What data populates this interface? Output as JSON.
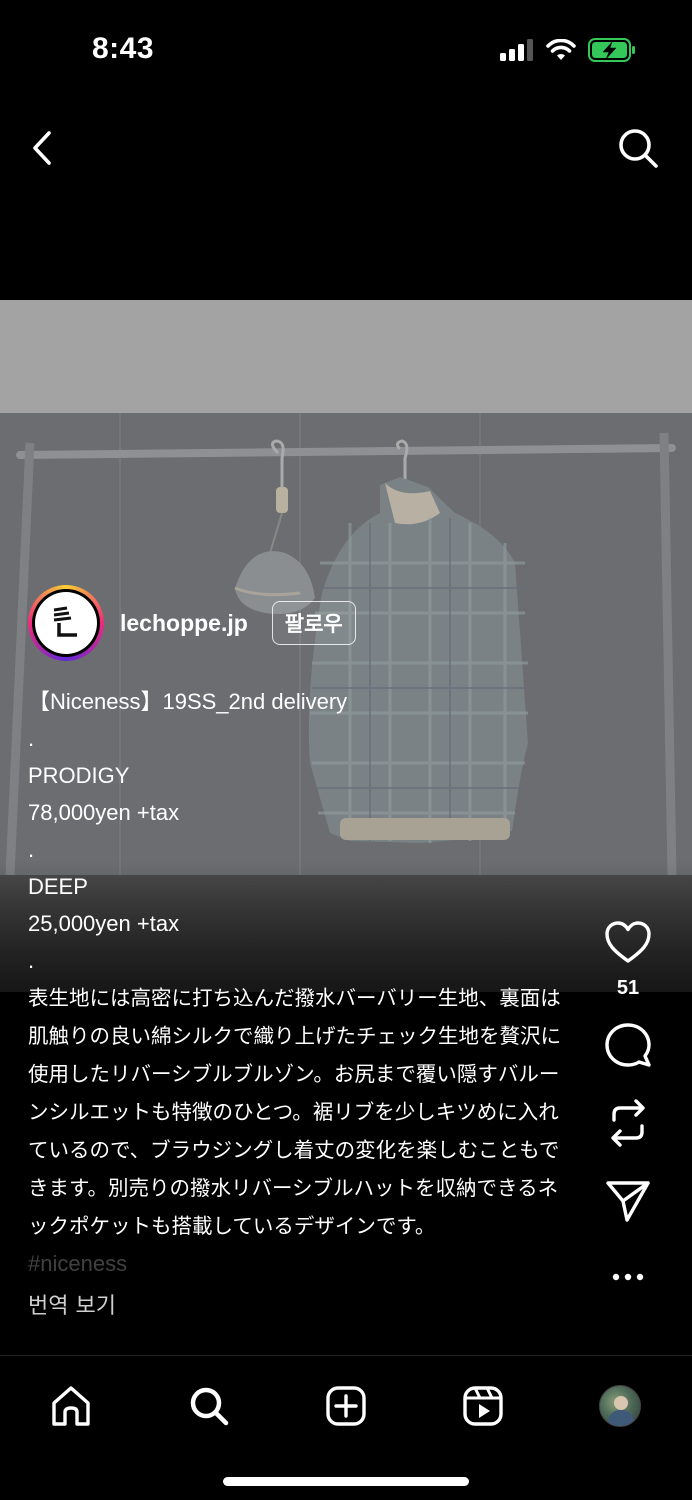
{
  "status": {
    "time": "8:43"
  },
  "author": {
    "username": "lechoppe.jp",
    "follow_label": "팔로우"
  },
  "caption": {
    "line1": "【Niceness】19SS_2nd delivery",
    "dot": ".",
    "item1_name": "PRODIGY",
    "item1_price": "78,000yen +tax",
    "item2_name": "DEEP",
    "item2_price": "25,000yen +tax",
    "body": "表生地には高密に打ち込んだ撥水バーバリー生地、裏面は肌触りの良い綿シルクで織り上げたチェック生地を贅沢に使用したリバーシブルブルゾン。お尻まで覆い隠すバルーンシルエットも特徴のひとつ。裾リブを少しキツめに入れているので、ブラウジングし着丈の変化を楽しむこともできます。別売りの撥水リバーシブルハットを収納できるネックポケットも搭載しているデザインです。",
    "hashtag": "#niceness"
  },
  "translate_label": "번역 보기",
  "actions": {
    "like_count": "51"
  },
  "icons": {
    "back": "chevron-left-icon",
    "search": "search-icon",
    "like": "heart-icon",
    "comment": "comment-icon",
    "remix": "remix-icon",
    "share": "send-icon",
    "more": "more-icon"
  },
  "colors": {
    "battery": "#34c759",
    "background": "#000000"
  }
}
